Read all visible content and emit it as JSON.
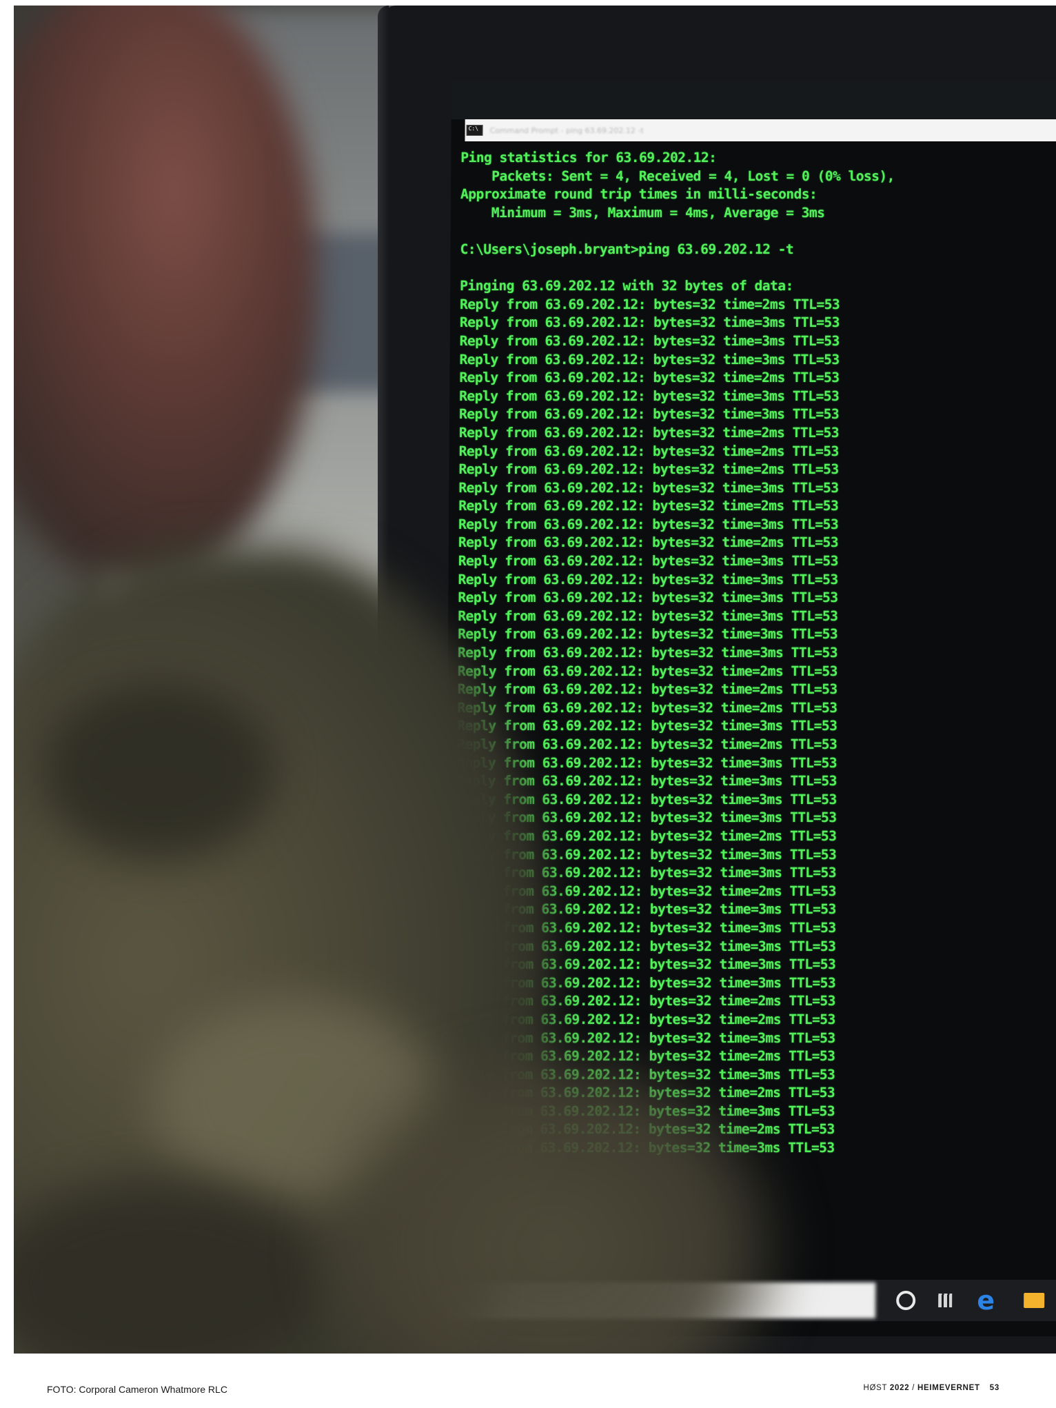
{
  "photo": {
    "window_title": "Command Prompt - ping 63.69.202.12 -t",
    "terminal_lines": [
      "Ping statistics for 63.69.202.12:",
      "    Packets: Sent = 4, Received = 4, Lost = 0 (0% loss),",
      "Approximate round trip times in milli-seconds:",
      "    Minimum = 3ms, Maximum = 4ms, Average = 3ms",
      "",
      "C:\\Users\\joseph.bryant>ping 63.69.202.12 -t",
      "",
      "Pinging 63.69.202.12 with 32 bytes of data:"
    ],
    "reply_times": [
      "2ms",
      "3ms",
      "3ms",
      "3ms",
      "2ms",
      "3ms",
      "3ms",
      "2ms",
      "2ms",
      "2ms",
      "3ms",
      "2ms",
      "3ms",
      "2ms",
      "3ms",
      "3ms",
      "3ms",
      "3ms",
      "3ms",
      "3ms",
      "2ms",
      "2ms",
      "2ms",
      "3ms",
      "2ms",
      "3ms",
      "3ms",
      "3ms",
      "3ms",
      "2ms",
      "3ms",
      "3ms",
      "2ms",
      "3ms",
      "3ms",
      "3ms",
      "3ms",
      "3ms",
      "2ms",
      "2ms",
      "3ms",
      "2ms",
      "3ms",
      "2ms",
      "3ms",
      "2ms",
      "3ms"
    ],
    "reply_template": {
      "prefix": "Reply from 63.69.202.12: bytes=32 time=",
      "suffix": " TTL=53"
    },
    "taskbar_icons": [
      "cortana-icon",
      "task-view-icon",
      "edge-icon",
      "file-explorer-icon"
    ],
    "colors": {
      "terminal_text": "#53f05b",
      "terminal_bg": "#0a0c0e",
      "edge": "#2b84e6",
      "folder": "#f3b32c"
    }
  },
  "footer": {
    "credit": "FOTO: Corporal Cameron Whatmore RLC",
    "season": "HØST",
    "year": "2022",
    "separator": "/",
    "magazine": "HEIMEVERNET",
    "page_number": "53"
  }
}
